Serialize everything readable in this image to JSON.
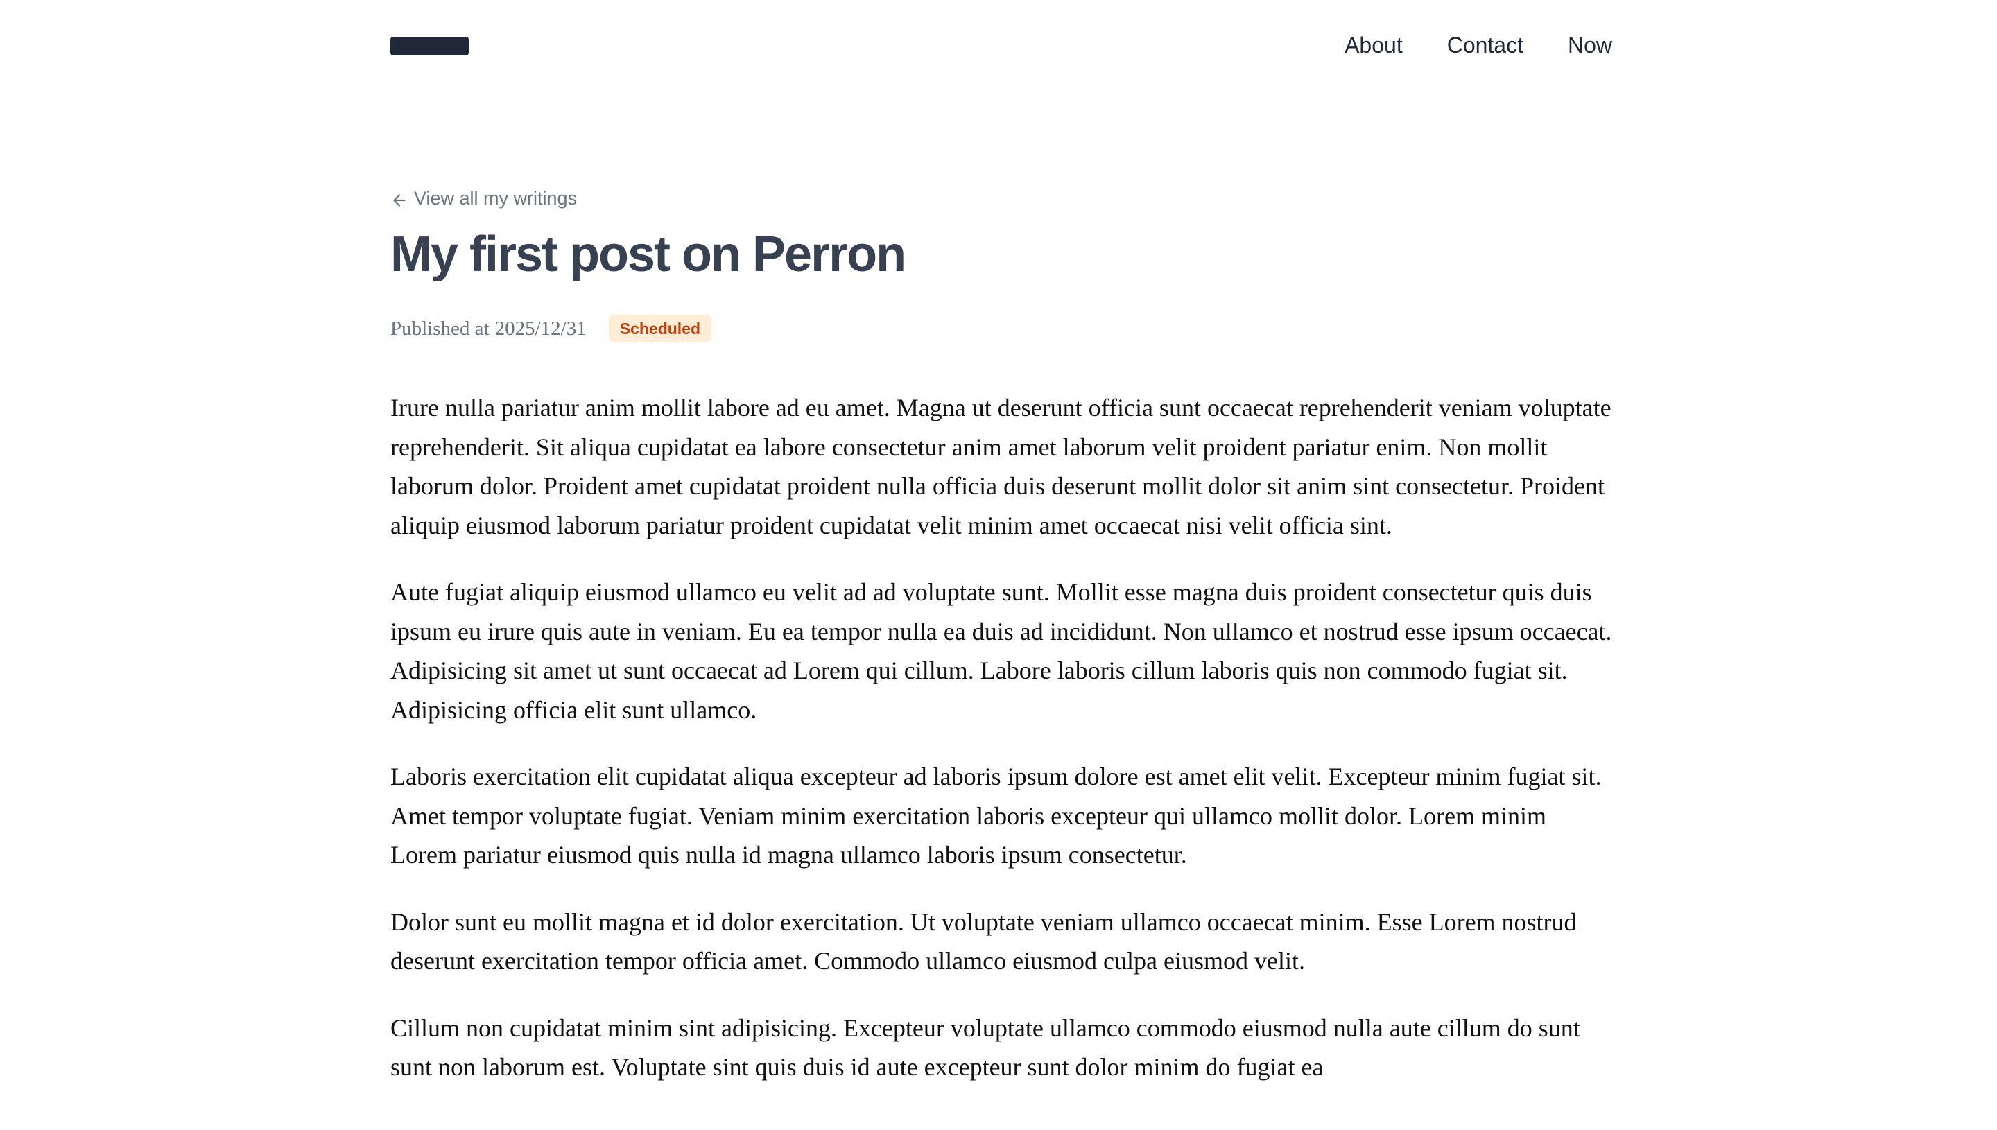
{
  "header": {
    "logo_label": "",
    "nav": [
      {
        "label": "About"
      },
      {
        "label": "Contact"
      },
      {
        "label": "Now"
      }
    ]
  },
  "post": {
    "back_link": "View all my writings",
    "title": "My first post on Perron",
    "published_label": "Published at",
    "published_date": "2025/12/31",
    "status_badge": "Scheduled",
    "paragraphs": [
      "Irure nulla pariatur anim mollit labore ad eu amet. Magna ut deserunt officia sunt occaecat reprehenderit veniam voluptate reprehenderit. Sit aliqua cupidatat ea labore consectetur anim amet laborum velit proident pariatur enim. Non mollit laborum dolor. Proident amet cupidatat proident nulla officia duis deserunt mollit dolor sit anim sint consectetur. Proident aliquip eiusmod laborum pariatur proident cupidatat velit minim amet occaecat nisi velit officia sint.",
      "Aute fugiat aliquip eiusmod ullamco eu velit ad ad voluptate sunt. Mollit esse magna duis proident consectetur quis duis ipsum eu irure quis aute in veniam. Eu ea tempor nulla ea duis ad incididunt. Non ullamco et nostrud esse ipsum occaecat. Adipisicing sit amet ut sunt occaecat ad Lorem qui cillum. Labore laboris cillum laboris quis non commodo fugiat sit. Adipisicing officia elit sunt ullamco.",
      "Laboris exercitation elit cupidatat aliqua excepteur ad laboris ipsum dolore est amet elit velit. Excepteur minim fugiat sit. Amet tempor voluptate fugiat. Veniam minim exercitation laboris excepteur qui ullamco mollit dolor. Lorem minim Lorem pariatur eiusmod quis nulla id magna ullamco laboris ipsum consectetur.",
      "Dolor sunt eu mollit magna et id dolor exercitation. Ut voluptate veniam ullamco occaecat minim. Esse Lorem nostrud deserunt exercitation tempor officia amet. Commodo ullamco eiusmod culpa eiusmod velit.",
      "Cillum non cupidatat minim sint adipisicing. Excepteur voluptate ullamco commodo eiusmod nulla aute cillum do sunt sunt non laborum est. Voluptate sint quis duis id aute excepteur sunt dolor minim do fugiat ea"
    ]
  },
  "colors": {
    "logo": "#1f2937",
    "title": "#374151",
    "muted": "#6b7280",
    "badge_text": "#c2410c",
    "badge_bg": "#ffedd5"
  },
  "icons": {
    "back": "arrow-left-icon"
  }
}
